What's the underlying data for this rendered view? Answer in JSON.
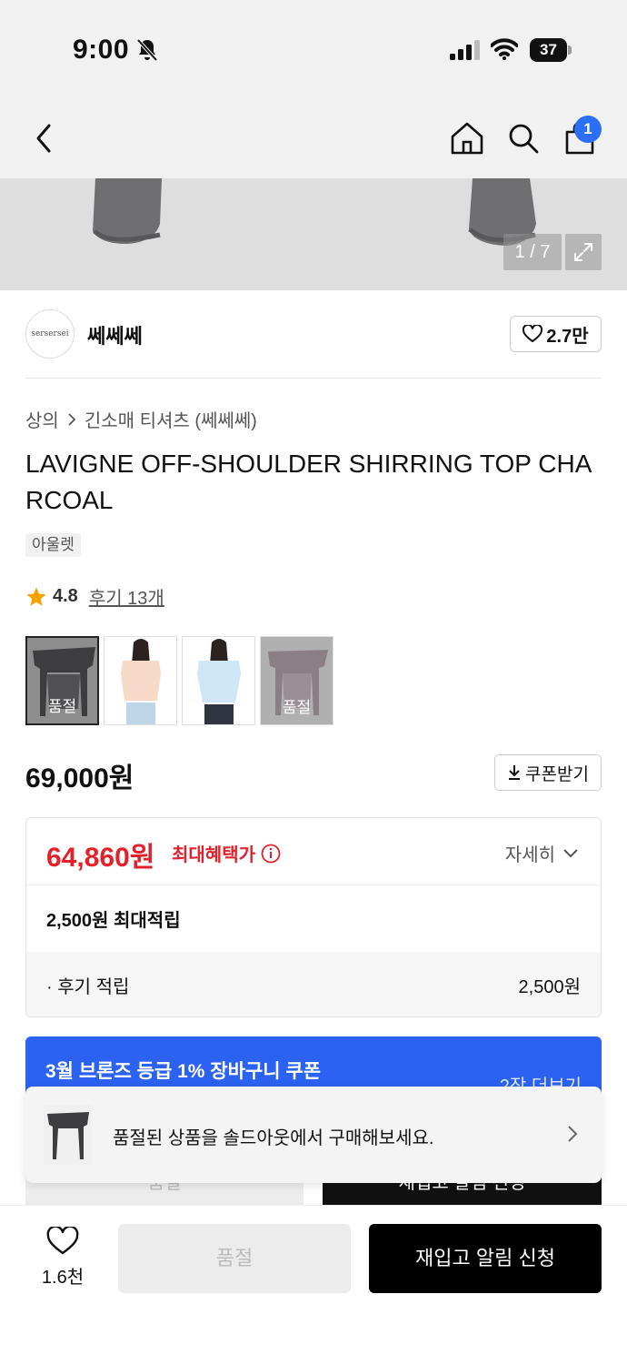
{
  "status_bar": {
    "time": "9:00",
    "battery": "37"
  },
  "nav": {
    "cart_count": "1"
  },
  "gallery": {
    "counter": "1 / 7"
  },
  "brand": {
    "logo_text": "sersersei",
    "name": "쎄쎄쎄",
    "likes": "2.7만"
  },
  "breadcrumb": {
    "category": "상의",
    "subcategory": "긴소매 티셔츠 (쎄쎄쎄)"
  },
  "product": {
    "title": "LAVIGNE OFF-SHOULDER SHIRRING TOP CHARCOAL",
    "tag": "아울렛",
    "rating": "4.8",
    "reviews": "후기 13개",
    "price": "69,000원"
  },
  "thumbnails": [
    {
      "label": "품절"
    },
    {
      "label": ""
    },
    {
      "label": ""
    },
    {
      "label": "품절"
    }
  ],
  "coupon_button": {
    "label": "쿠폰받기"
  },
  "benefit": {
    "sale_price": "64,860원",
    "sale_label": "최대혜택가",
    "detail": "자세히",
    "points": "2,500원 최대적립",
    "review_points_label": "· 후기 적립",
    "review_points_value": "2,500원"
  },
  "coupon_banner": {
    "title": "3월 브론즈 등급 1% 장바구니 쿠폰",
    "more": "2장 더보기"
  },
  "hidden_buttons": {
    "left": "품절",
    "right": "재입고 알림 신청"
  },
  "toast": {
    "message": "품절된 상품을 솔드아웃에서 구매해보세요."
  },
  "bottom": {
    "wish_count": "1.6천",
    "soldout": "품절",
    "restock": "재입고 알림 신청"
  },
  "colors": {
    "accent_blue": "#2b62f2",
    "sale_red": "#e3212b"
  }
}
